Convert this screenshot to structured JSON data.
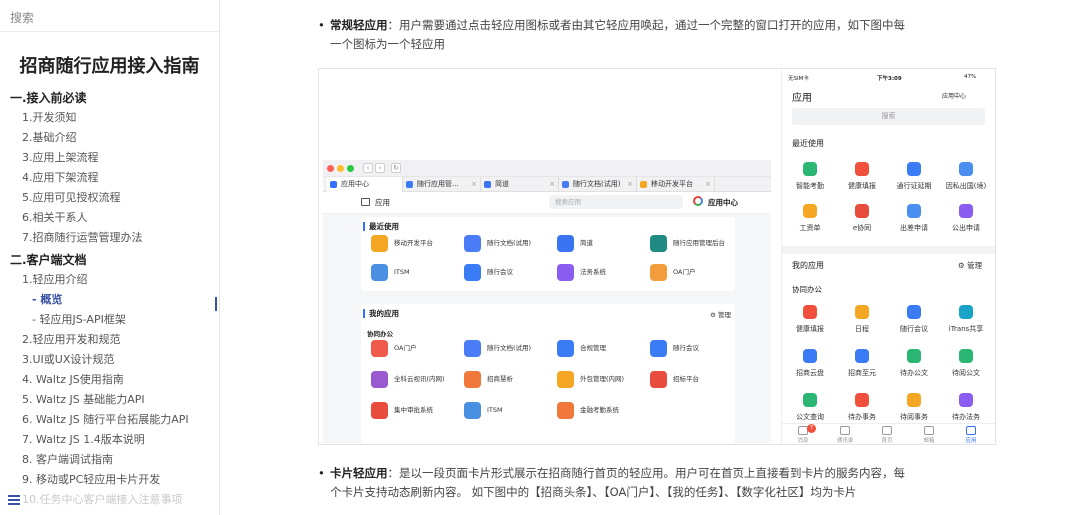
{
  "sidebar": {
    "search_placeholder": "搜索",
    "title": "招商随行应用接入指南",
    "sections": [
      {
        "label": "一.接入前必读",
        "items": [
          {
            "label": "1.开发须知",
            "level": 1
          },
          {
            "label": "2.基础介绍",
            "level": 1
          },
          {
            "label": "3.应用上架流程",
            "level": 1
          },
          {
            "label": "4.应用下架流程",
            "level": 1
          },
          {
            "label": "5.应用可见授权流程",
            "level": 1
          },
          {
            "label": "6.相关干系人",
            "level": 1
          },
          {
            "label": "7.招商随行运营管理办法",
            "level": 1
          }
        ]
      },
      {
        "label": "二.客户端文档",
        "items": [
          {
            "label": "1.轻应用介绍",
            "level": 1
          },
          {
            "label": "- 概览",
            "level": 2,
            "active": true
          },
          {
            "label": "- 轻应用JS-API框架",
            "level": 2
          },
          {
            "label": "2.轻应用开发和规范",
            "level": 1
          },
          {
            "label": "3.UI或UX设计规范",
            "level": 1
          },
          {
            "label": "4. Waltz JS使用指南",
            "level": 1
          },
          {
            "label": "5. Waltz JS 基础能力API",
            "level": 1
          },
          {
            "label": "6. Waltz JS 随行平台拓展能力API",
            "level": 1
          },
          {
            "label": "7. Waltz JS 1.4版本说明",
            "level": 1
          },
          {
            "label": "8. 客户端调试指南",
            "level": 1
          },
          {
            "label": "9. 移动或PC轻应用卡片开发",
            "level": 1
          },
          {
            "label": "10.任务中心客户端接入注意事项",
            "level": 1,
            "faded": true
          }
        ]
      }
    ]
  },
  "content": {
    "p1": {
      "term": "常规轻应用",
      "text": "：用户需要通过点击轻应用图标或者由其它轻应用唤起，通过一个完整的窗口打开的应用，如下图中每一个图标为一个轻应用"
    },
    "p2": {
      "term": "卡片轻应用",
      "text": "：是以一段页面卡片形式展示在招商随行首页的轻应用。用户可在首页上直接看到卡片的服务内容，每个卡片支持动态刷新内容。 如下图中的【招商头条】、【OA门户】、【我的任务】、【数字化社区】均为卡片"
    }
  },
  "desktop": {
    "tabs": [
      "应用中心",
      "随行应用管...",
      "简道",
      "随行文档(试用)",
      "移动开发平台"
    ],
    "toolbar_title": "应用",
    "search_placeholder": "搜索应用",
    "brand": "应用中心",
    "recent_title": "最近使用",
    "recent_apps": [
      {
        "name": "移动开发平台",
        "color": "#f5a623"
      },
      {
        "name": "随行文档(试用)",
        "color": "#4a7cf7"
      },
      {
        "name": "简道",
        "color": "#3b74f2"
      },
      {
        "name": "随行应用管理后台",
        "color": "#1f8a82"
      },
      {
        "name": "ITSM",
        "color": "#4a90e2"
      },
      {
        "name": "随行会议",
        "color": "#3a7bf6"
      },
      {
        "name": "法务系统",
        "color": "#8a5cf0"
      },
      {
        "name": "OA门户",
        "color": "#f39c3b"
      }
    ],
    "my_title": "我的应用",
    "manage": "管理",
    "group": "协同办公",
    "my_apps": [
      {
        "name": "OA门户",
        "color": "#f05a4a"
      },
      {
        "name": "随行文档(试用)",
        "color": "#4a7cf7"
      },
      {
        "name": "合规管理",
        "color": "#3a7bf6"
      },
      {
        "name": "随行会议",
        "color": "#3a7bf6"
      },
      {
        "name": "全科云视讯(内网)",
        "color": "#9b59d0"
      },
      {
        "name": "招商慧析",
        "color": "#f0783a"
      },
      {
        "name": "外包管理(内网)",
        "color": "#f5a623"
      },
      {
        "name": "招标平台",
        "color": "#e74c3c"
      },
      {
        "name": "集中审批系统",
        "color": "#e74c3c"
      },
      {
        "name": "ITSM",
        "color": "#4a90e2"
      },
      {
        "name": "金融考勤系统",
        "color": "#f0783a"
      }
    ]
  },
  "phone": {
    "carrier": "无SIM卡",
    "time": "下午3:09",
    "battery": "47%",
    "title": "应用",
    "brand": "应用中心",
    "search": "搜索",
    "recent_title": "最近使用",
    "recent": [
      {
        "name": "智能考勤",
        "color": "#2bb673"
      },
      {
        "name": "健康填报",
        "color": "#f0503c"
      },
      {
        "name": "通行证延期",
        "color": "#3a7bf6"
      },
      {
        "name": "因私出国(境)",
        "color": "#4a8ef0"
      },
      {
        "name": "工资单",
        "color": "#f5a623"
      },
      {
        "name": "e协同",
        "color": "#e74c3c"
      },
      {
        "name": "出差申请",
        "color": "#4a8ef0"
      },
      {
        "name": "公出申请",
        "color": "#8a5cf0"
      }
    ],
    "my_title": "我的应用",
    "manage": "管理",
    "group": "协同办公",
    "my": [
      {
        "name": "健康填报",
        "color": "#f0503c"
      },
      {
        "name": "日程",
        "color": "#f5a623"
      },
      {
        "name": "随行会议",
        "color": "#3a7bf6"
      },
      {
        "name": "iTrans共享",
        "color": "#1aa3c8"
      },
      {
        "name": "招商云盘",
        "color": "#3a7bf6"
      },
      {
        "name": "招商至元",
        "color": "#3a7bf6"
      },
      {
        "name": "待办公文",
        "color": "#2bb673"
      },
      {
        "name": "待阅公文",
        "color": "#2bb673"
      },
      {
        "name": "公文查询",
        "color": "#2bb673"
      },
      {
        "name": "待办事务",
        "color": "#f0503c"
      },
      {
        "name": "待阅事务",
        "color": "#f5a623"
      },
      {
        "name": "待办法务",
        "color": "#8a5cf0"
      }
    ],
    "tabbar": [
      {
        "label": "消息",
        "badge": "7"
      },
      {
        "label": "通讯录"
      },
      {
        "label": "首页"
      },
      {
        "label": "邮箱"
      },
      {
        "label": "应用",
        "active": true
      }
    ]
  }
}
